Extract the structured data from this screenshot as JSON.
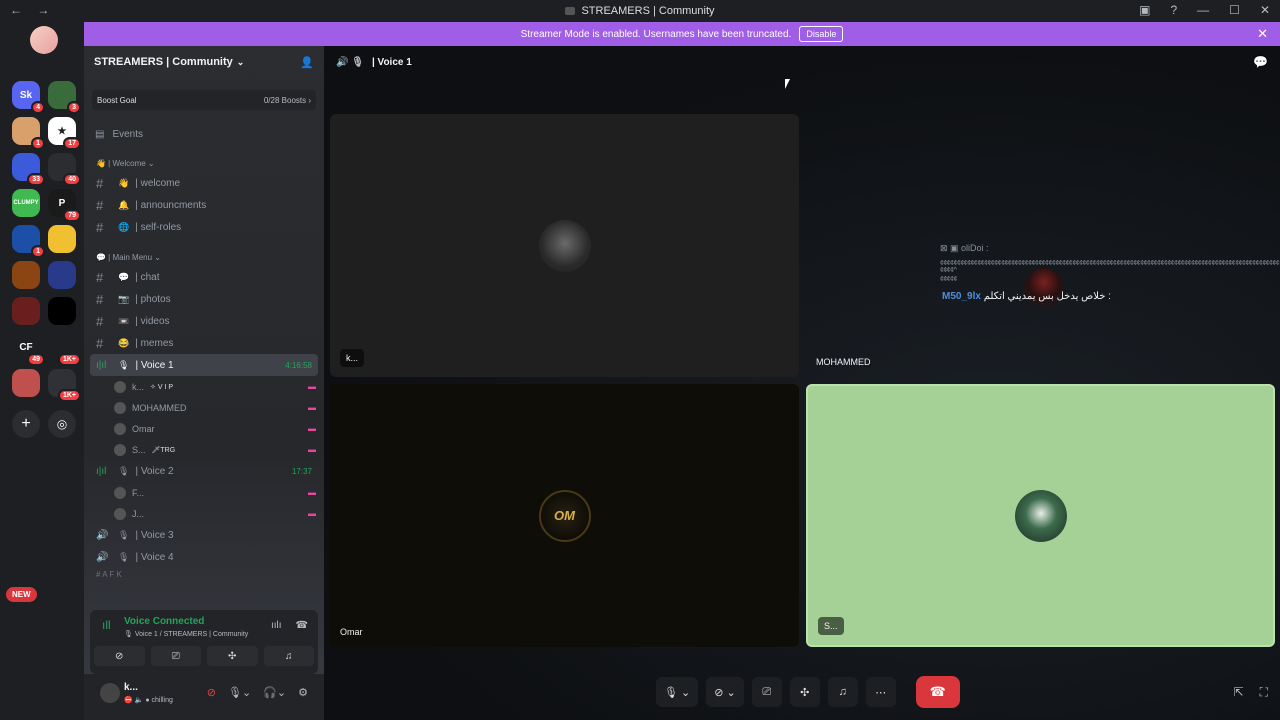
{
  "titlebar": {
    "nav": "← →",
    "title": "STREAMERS | Community",
    "icons": [
      "inbox-icon",
      "help-icon",
      "minimize-icon",
      "maximize-icon",
      "close-icon"
    ]
  },
  "servers": {
    "items": [
      {
        "label": "Sk",
        "badge": "4",
        "color": "#5865f2"
      },
      {
        "label": "",
        "badge": "3",
        "color": "#3a6b3a"
      },
      {
        "label": "",
        "badge": "1",
        "color": "#d9a06b"
      },
      {
        "label": "★",
        "badge": "17",
        "color": "#ffffff"
      },
      {
        "label": "",
        "badge": "33",
        "color": "#3b5bdb"
      },
      {
        "label": "",
        "badge": "40",
        "color": "#2b2d31"
      },
      {
        "label": "CLUMPY",
        "badge": "",
        "color": "#3fb950"
      },
      {
        "label": "P",
        "badge": "79",
        "color": "#1a1a1a"
      },
      {
        "label": "",
        "badge": "1",
        "color": "#1c4fa8"
      },
      {
        "label": "",
        "badge": "",
        "color": "#f0c030"
      },
      {
        "label": "",
        "badge": "",
        "color": "#8b4513"
      },
      {
        "label": "",
        "badge": "",
        "color": "#2a3a8a"
      },
      {
        "label": "",
        "badge": "",
        "color": "#6a1f1f"
      },
      {
        "label": "",
        "badge": "",
        "color": "#000000"
      },
      {
        "label": "CF",
        "badge": "49",
        "color": "#1e1f22"
      },
      {
        "label": "",
        "badge": "1K+",
        "color": "#1e1f22"
      },
      {
        "label": "",
        "badge": "",
        "color": "#c0504d"
      },
      {
        "label": "",
        "badge": "1K+",
        "color": "#2f3136"
      }
    ],
    "new_badge": "NEW"
  },
  "banner": {
    "text": "Streamer Mode is enabled. Usernames have been truncated.",
    "button": "Disable"
  },
  "guild": {
    "name": "STREAMERS | Community",
    "boost_label": "Boost Goal",
    "boost_count": "0/28 Boosts",
    "events": "Events",
    "categories": {
      "welcome": "👋 | Welcome",
      "main": "💬 | Main Menu"
    },
    "text_channels_welcome": [
      {
        "emoji": "👋",
        "name": "| welcome"
      },
      {
        "emoji": "🔔",
        "name": "| announcments"
      },
      {
        "emoji": "🌐",
        "name": "| self-roles"
      }
    ],
    "text_channels_main": [
      {
        "emoji": "💬",
        "name": "| chat"
      },
      {
        "emoji": "📷",
        "name": "| photos"
      },
      {
        "emoji": "📼",
        "name": "| videos"
      },
      {
        "emoji": "😂",
        "name": "| memes"
      }
    ],
    "voice1": {
      "name": "| Voice 1",
      "time": "4:16:58"
    },
    "voice1_users": [
      {
        "name": "k...",
        "tag": "✧ V I P"
      },
      {
        "name": "MOHAMMED",
        "tag": ""
      },
      {
        "name": "Omar",
        "tag": ""
      },
      {
        "name": "S...",
        "tag": "🗡TRG"
      }
    ],
    "voice2": {
      "name": "| Voice 2",
      "time": "17:37"
    },
    "voice2_users": [
      {
        "name": "F..."
      },
      {
        "name": "J..."
      }
    ],
    "voice3": "| Voice 3",
    "voice4": "| Voice 4",
    "afk": "# A F K"
  },
  "voice_connected": {
    "title": "Voice Connected",
    "subtitle": "Voice 1 / STREAMERS | Community"
  },
  "user": {
    "name": "k...",
    "status": "chilling"
  },
  "main": {
    "channel": "| Voice 1",
    "tiles": [
      {
        "label": "k..."
      },
      {
        "label": "MOHAMMED"
      },
      {
        "label": "Omar",
        "avatar_text": "OM"
      },
      {
        "label": "S..."
      }
    ],
    "stream_overlay": {
      "line1": "oliDoi :",
      "line2": "¢¢¢¢¢¢¢¢¢¢¢¢¢¢¢¢¢¢¢¢¢¢¢¢¢¢¢¢¢¢¢¢¢¢¢¢¢¢¢¢¢¢¢¢¢¢¢¢¢¢¢¢¢¢¢¢¢¢¢¢¢¢¢¢¢¢¢¢¢¢¢¢¢¢¢¢¢¢¢¢¢¢¢¢¢¢¢¢¢¢¢¢¢¢¢¢¢¢¢¢¢¢¢¢^",
      "line3": "¢¢¢¢¢",
      "user": "M50_9lx",
      "msg": "خلاص يدخل بس يمديني اتكلم :"
    }
  }
}
